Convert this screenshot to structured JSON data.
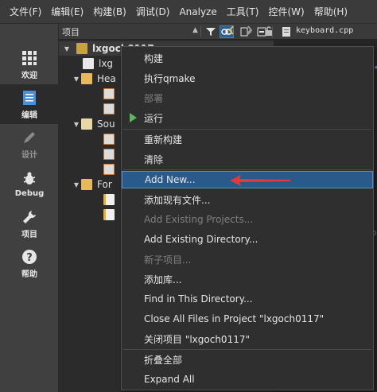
{
  "menubar": {
    "items": [
      "文件(F)",
      "编辑(E)",
      "构建(B)",
      "调试(D)",
      "Analyze",
      "工具(T)",
      "控件(W)",
      "帮助(H)"
    ]
  },
  "modes": [
    {
      "label": "欢迎",
      "icon": "grid-icon"
    },
    {
      "label": "编辑",
      "icon": "edit-document-icon"
    },
    {
      "label": "设计",
      "icon": "pencil-icon"
    },
    {
      "label": "Debug",
      "icon": "bug-icon"
    },
    {
      "label": "项目",
      "icon": "wrench-icon"
    },
    {
      "label": "帮助",
      "icon": "help-icon"
    }
  ],
  "toolbar": {
    "view_label": "项目",
    "open_file": "keyboard.cpp"
  },
  "tree": {
    "project": "lxgoch0117",
    "pro_file": "lxg",
    "headers": "Hea",
    "sources": "Sou",
    "forms": "For"
  },
  "editor": {
    "hint1": "<<",
    "hint2": "pp"
  },
  "context_menu": {
    "items": [
      {
        "label": "构建",
        "disabled": false
      },
      {
        "label": "执行qmake",
        "disabled": false
      },
      {
        "label": "部署",
        "disabled": true
      },
      {
        "label": "运行",
        "disabled": false
      },
      {
        "label": "重新构建",
        "disabled": false
      },
      {
        "label": "清除",
        "disabled": false
      },
      {
        "label": "Add New...",
        "disabled": false,
        "highlighted": true
      },
      {
        "label": "添加现有文件...",
        "disabled": false
      },
      {
        "label": "Add Existing Projects...",
        "disabled": true
      },
      {
        "label": "Add Existing Directory...",
        "disabled": false
      },
      {
        "label": "新子项目...",
        "disabled": true
      },
      {
        "label": "添加库...",
        "disabled": false
      },
      {
        "label": "Find in This Directory...",
        "disabled": false
      },
      {
        "label": "Close All Files in Project \"lxgoch0117\"",
        "disabled": false
      },
      {
        "label": "关闭项目 \"lxgoch0117\"",
        "disabled": false
      },
      {
        "label": "折叠全部",
        "disabled": false
      },
      {
        "label": "Expand All",
        "disabled": false
      }
    ]
  },
  "colors": {
    "highlight": "#2a5a8c",
    "run_icon": "#5bb85b",
    "annotation_arrow": "#e8383b"
  }
}
